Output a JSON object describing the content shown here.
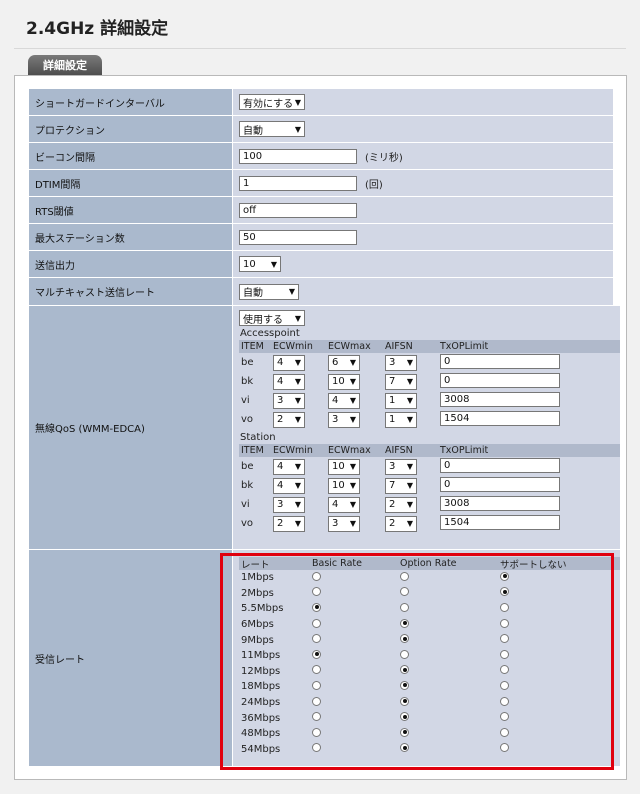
{
  "page": {
    "title": "2.4GHz 詳細設定",
    "tab_label": "詳細設定"
  },
  "settings": {
    "short_guard": {
      "label": "ショートガードインターバル",
      "value": "有効にする"
    },
    "protection": {
      "label": "プロテクション",
      "value": "自動"
    },
    "beacon": {
      "label": "ビーコン間隔",
      "value": "100",
      "unit": "(ミリ秒)"
    },
    "dtim": {
      "label": "DTIM間隔",
      "value": "1",
      "unit": "(回)"
    },
    "rts": {
      "label": "RTS閾値",
      "value": "off"
    },
    "max_station": {
      "label": "最大ステーション数",
      "value": "50"
    },
    "tx_power": {
      "label": "送信出力",
      "value": "10"
    },
    "multicast_rate": {
      "label": "マルチキャスト送信レート",
      "value": "自動"
    }
  },
  "qos": {
    "label": "無線QoS (WMM-EDCA)",
    "enable": "使用する",
    "headers": [
      "ITEM",
      "ECWmin",
      "ECWmax",
      "AIFSN",
      "TxOPLimit"
    ],
    "accesspoint": {
      "title": "Accesspoint",
      "rows": [
        {
          "item": "be",
          "ecwmin": "4",
          "ecwmax": "6",
          "aifsn": "3",
          "txop": "0"
        },
        {
          "item": "bk",
          "ecwmin": "4",
          "ecwmax": "10",
          "aifsn": "7",
          "txop": "0"
        },
        {
          "item": "vi",
          "ecwmin": "3",
          "ecwmax": "4",
          "aifsn": "1",
          "txop": "3008"
        },
        {
          "item": "vo",
          "ecwmin": "2",
          "ecwmax": "3",
          "aifsn": "1",
          "txop": "1504"
        }
      ]
    },
    "station": {
      "title": "Station",
      "rows": [
        {
          "item": "be",
          "ecwmin": "4",
          "ecwmax": "10",
          "aifsn": "3",
          "txop": "0"
        },
        {
          "item": "bk",
          "ecwmin": "4",
          "ecwmax": "10",
          "aifsn": "7",
          "txop": "0"
        },
        {
          "item": "vi",
          "ecwmin": "3",
          "ecwmax": "4",
          "aifsn": "2",
          "txop": "3008"
        },
        {
          "item": "vo",
          "ecwmin": "2",
          "ecwmax": "3",
          "aifsn": "2",
          "txop": "1504"
        }
      ]
    }
  },
  "rates": {
    "label": "受信レート",
    "headers": [
      "レート",
      "Basic Rate",
      "Option Rate",
      "サポートしない"
    ],
    "rows": [
      {
        "name": "1Mbps",
        "selected": "none"
      },
      {
        "name": "2Mbps",
        "selected": "none"
      },
      {
        "name": "5.5Mbps",
        "selected": "basic"
      },
      {
        "name": "6Mbps",
        "selected": "option"
      },
      {
        "name": "9Mbps",
        "selected": "option"
      },
      {
        "name": "11Mbps",
        "selected": "basic"
      },
      {
        "name": "12Mbps",
        "selected": "option"
      },
      {
        "name": "18Mbps",
        "selected": "option"
      },
      {
        "name": "24Mbps",
        "selected": "option"
      },
      {
        "name": "36Mbps",
        "selected": "option"
      },
      {
        "name": "48Mbps",
        "selected": "option"
      },
      {
        "name": "54Mbps",
        "selected": "option"
      }
    ]
  },
  "colors": {
    "highlight": "#e0000e",
    "label_bg": "#aab9cd",
    "value_bg": "#d2d7e5"
  }
}
